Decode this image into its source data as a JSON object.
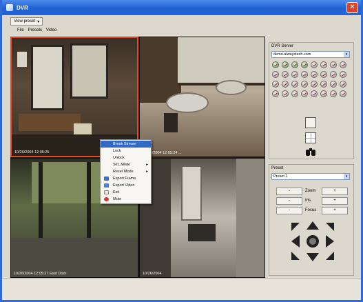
{
  "window": {
    "title": "DVR",
    "close_label": "✕"
  },
  "toolbar": {
    "view_dropdown_label": "View preset"
  },
  "menubar": {
    "items": [
      "File",
      "Presets",
      "Video"
    ]
  },
  "cameras": [
    {
      "timestamp": "10/26/2004  12:05:25",
      "selected": true
    },
    {
      "timestamp": "10/26/2004  12:05:24  ..."
    },
    {
      "timestamp": "10/26/2004  12:05:27  East Door"
    },
    {
      "timestamp": "10/26/2004"
    }
  ],
  "context_menu": {
    "items": [
      {
        "label": "Break Stream",
        "highlighted": true
      },
      {
        "label": "Lock"
      },
      {
        "label": "Unlock"
      },
      {
        "label": "Set_Mode",
        "has_submenu": true
      },
      {
        "label": "Reset Mode",
        "has_submenu": true
      },
      {
        "label": "Export Frame",
        "icon": "export-frame-icon"
      },
      {
        "label": "Export Video",
        "icon": "export-video-icon"
      },
      {
        "label": "Exit",
        "icon": "exit-icon"
      },
      {
        "label": "Mute",
        "icon": "mute-icon"
      }
    ]
  },
  "dvr_servers": {
    "label": "DVR Server",
    "selected": "demo.alwaystech.com",
    "camera_buttons_count": 32
  },
  "preset": {
    "label": "Preset",
    "selected": "Preset 1",
    "rows": [
      {
        "minus": "-",
        "label": "Zoom",
        "plus": "+"
      },
      {
        "minus": "-",
        "label": "Iris",
        "plus": "+"
      },
      {
        "minus": "-",
        "label": "Focus",
        "plus": "+"
      }
    ]
  },
  "colors": {
    "titlebar": "#1f5fd0",
    "selection_border": "#e04a2a",
    "menu_highlight": "#316ac5"
  }
}
